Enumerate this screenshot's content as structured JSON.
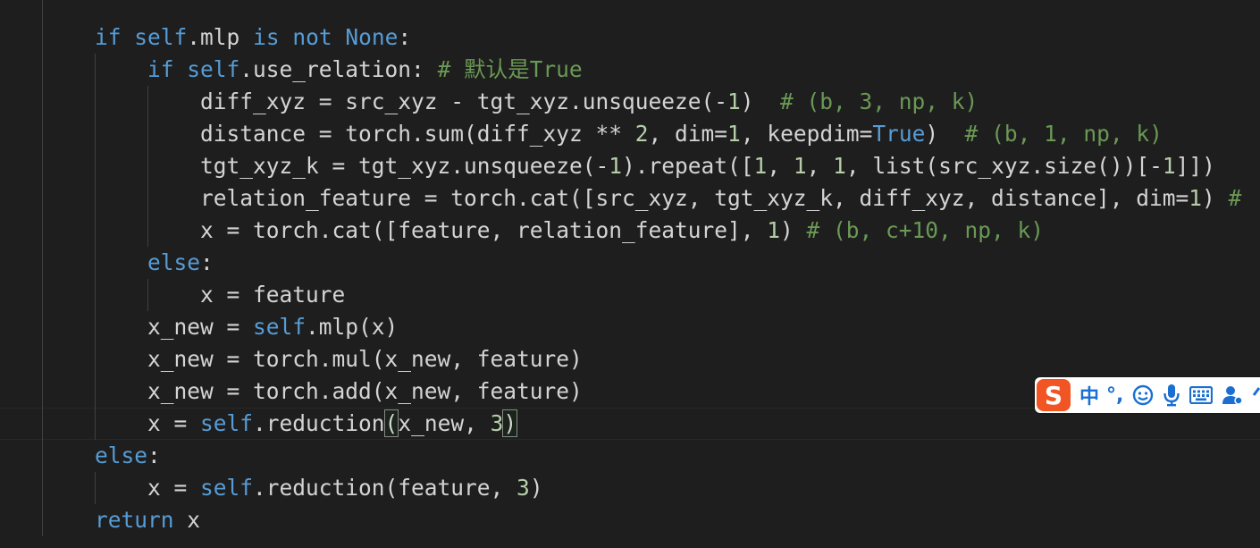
{
  "editor": {
    "top_partial": "\"\"\"",
    "lines": [
      {
        "indent": 1,
        "tokens": [
          [
            "kw",
            "if"
          ],
          [
            "t",
            " "
          ],
          [
            "kw",
            "self"
          ],
          [
            "t",
            ".mlp "
          ],
          [
            "kw",
            "is not None"
          ],
          [
            "t",
            ":"
          ]
        ]
      },
      {
        "indent": 2,
        "tokens": [
          [
            "kw",
            "if"
          ],
          [
            "t",
            " "
          ],
          [
            "kw",
            "self"
          ],
          [
            "t",
            ".use_relation: "
          ],
          [
            "cm",
            "# 默认是True"
          ]
        ]
      },
      {
        "indent": 3,
        "tokens": [
          [
            "t",
            "diff_xyz = src_xyz - tgt_xyz.unsqueeze(-"
          ],
          [
            "num",
            "1"
          ],
          [
            "t",
            ")  "
          ],
          [
            "cm",
            "# (b, 3, np, k)"
          ]
        ]
      },
      {
        "indent": 3,
        "tokens": [
          [
            "t",
            "distance = torch.sum(diff_xyz ** "
          ],
          [
            "num",
            "2"
          ],
          [
            "t",
            ", dim="
          ],
          [
            "num",
            "1"
          ],
          [
            "t",
            ", keepdim="
          ],
          [
            "kw",
            "True"
          ],
          [
            "t",
            ")  "
          ],
          [
            "cm",
            "# (b, 1, np, k)"
          ]
        ]
      },
      {
        "indent": 3,
        "tokens": [
          [
            "t",
            "tgt_xyz_k = tgt_xyz.unsqueeze(-"
          ],
          [
            "num",
            "1"
          ],
          [
            "t",
            ").repeat(["
          ],
          [
            "num",
            "1"
          ],
          [
            "t",
            ", "
          ],
          [
            "num",
            "1"
          ],
          [
            "t",
            ", "
          ],
          [
            "num",
            "1"
          ],
          [
            "t",
            ", list(src_xyz.size())[-"
          ],
          [
            "num",
            "1"
          ],
          [
            "t",
            "]])"
          ]
        ]
      },
      {
        "indent": 3,
        "tokens": [
          [
            "t",
            "relation_feature = torch.cat([src_xyz, tgt_xyz_k, diff_xyz, distance], dim="
          ],
          [
            "num",
            "1"
          ],
          [
            "t",
            ") "
          ],
          [
            "cm",
            "#"
          ]
        ]
      },
      {
        "indent": 3,
        "tokens": [
          [
            "t",
            "x = torch.cat([feature, relation_feature], "
          ],
          [
            "num",
            "1"
          ],
          [
            "t",
            ") "
          ],
          [
            "cm",
            "# (b, c+10, np, k)"
          ]
        ]
      },
      {
        "indent": 2,
        "tokens": [
          [
            "kw",
            "else"
          ],
          [
            "t",
            ":"
          ]
        ]
      },
      {
        "indent": 3,
        "tokens": [
          [
            "t",
            "x = feature"
          ]
        ]
      },
      {
        "indent": 2,
        "tokens": [
          [
            "t",
            "x_new = "
          ],
          [
            "kw",
            "self"
          ],
          [
            "t",
            ".mlp(x)"
          ]
        ]
      },
      {
        "indent": 2,
        "tokens": [
          [
            "t",
            "x_new = torch.mul(x_new, feature)"
          ]
        ]
      },
      {
        "indent": 2,
        "tokens": [
          [
            "t",
            "x_new = torch.add(x_new, feature)"
          ]
        ]
      },
      {
        "indent": 2,
        "tokens": [
          [
            "t",
            "x = "
          ],
          [
            "kw",
            "self"
          ],
          [
            "t",
            ".reduction"
          ],
          [
            "bm",
            "("
          ],
          [
            "t",
            "x_new, "
          ],
          [
            "num",
            "3"
          ],
          [
            "bm",
            ")"
          ]
        ]
      },
      {
        "indent": 1,
        "tokens": [
          [
            "kw",
            "else"
          ],
          [
            "t",
            ":"
          ]
        ]
      },
      {
        "indent": 2,
        "tokens": [
          [
            "t",
            "x = "
          ],
          [
            "kw",
            "self"
          ],
          [
            "t",
            ".reduction(feature, "
          ],
          [
            "num",
            "3"
          ],
          [
            "t",
            ")"
          ]
        ]
      },
      {
        "indent": 1,
        "tokens": [
          [
            "kw",
            "return"
          ],
          [
            "t",
            " x"
          ]
        ]
      }
    ]
  },
  "ime_toolbar": {
    "logo": "S",
    "mode_label": "中",
    "punct_label": "°,",
    "icons": [
      "emoji-icon",
      "microphone-icon",
      "keyboard-icon",
      "user-settings-icon",
      "more-icon"
    ]
  },
  "colors": {
    "background": "#1e1e1e",
    "keyword": "#569cd6",
    "number": "#b5cea8",
    "comment": "#6a9955",
    "text": "#d4d4d4",
    "ime_logo": "#f05523",
    "ime_accent": "#1a6fd1"
  }
}
